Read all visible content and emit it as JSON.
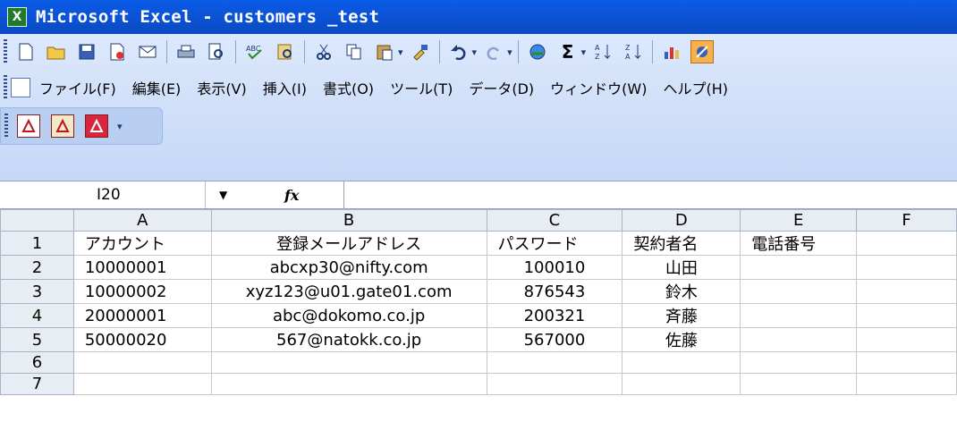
{
  "window": {
    "title": "Microsoft Excel - customers _test",
    "app_icon_letter": "X"
  },
  "menu": {
    "items": [
      "ファイル(F)",
      "編集(E)",
      "表示(V)",
      "挿入(I)",
      "書式(O)",
      "ツール(T)",
      "データ(D)",
      "ウィンドウ(W)",
      "ヘルプ(H)"
    ]
  },
  "formula_bar": {
    "cell_reference": "I20",
    "fx_label": "fx",
    "formula_value": ""
  },
  "toolbar": {
    "icons": [
      "new-icon",
      "open-icon",
      "save-icon",
      "permission-icon",
      "print-preview-icon",
      "print-icon",
      "print-preview2-icon",
      "spelling-icon",
      "research-icon",
      "cut-icon",
      "copy-icon",
      "paste-icon",
      "format-painter-icon",
      "undo-icon",
      "redo-icon",
      "hyperlink-icon",
      "autosum-icon",
      "sort-ascending-icon",
      "sort-descending-icon",
      "chart-wizard-icon",
      "drawing-icon"
    ],
    "sum_glyph": "Σ"
  },
  "sheet": {
    "column_headers": [
      "A",
      "B",
      "C",
      "D",
      "E",
      "F"
    ],
    "row_headers": [
      "1",
      "2",
      "3",
      "4",
      "5",
      "6",
      "7"
    ],
    "rows": [
      [
        "アカウント",
        "登録メールアドレス",
        "パスワード",
        "契約者名",
        "電話番号",
        ""
      ],
      [
        "10000001",
        "abcxp30@nifty.com",
        "100010",
        "山田",
        "",
        ""
      ],
      [
        "10000002",
        "xyz123@u01.gate01.com",
        "876543",
        "鈴木",
        "",
        ""
      ],
      [
        "20000001",
        "abc@dokomo.co.jp",
        "200321",
        "斉藤",
        "",
        ""
      ],
      [
        "50000020",
        "567@natokk.co.jp",
        "567000",
        "佐藤",
        "",
        ""
      ],
      [
        "",
        "",
        "",
        "",
        "",
        ""
      ],
      [
        "",
        "",
        "",
        "",
        "",
        ""
      ]
    ]
  },
  "colors": {
    "title_bar": "#0b53d7",
    "toolbar_bg": "#c5d8f6",
    "header_bg": "#e8ecf3"
  }
}
